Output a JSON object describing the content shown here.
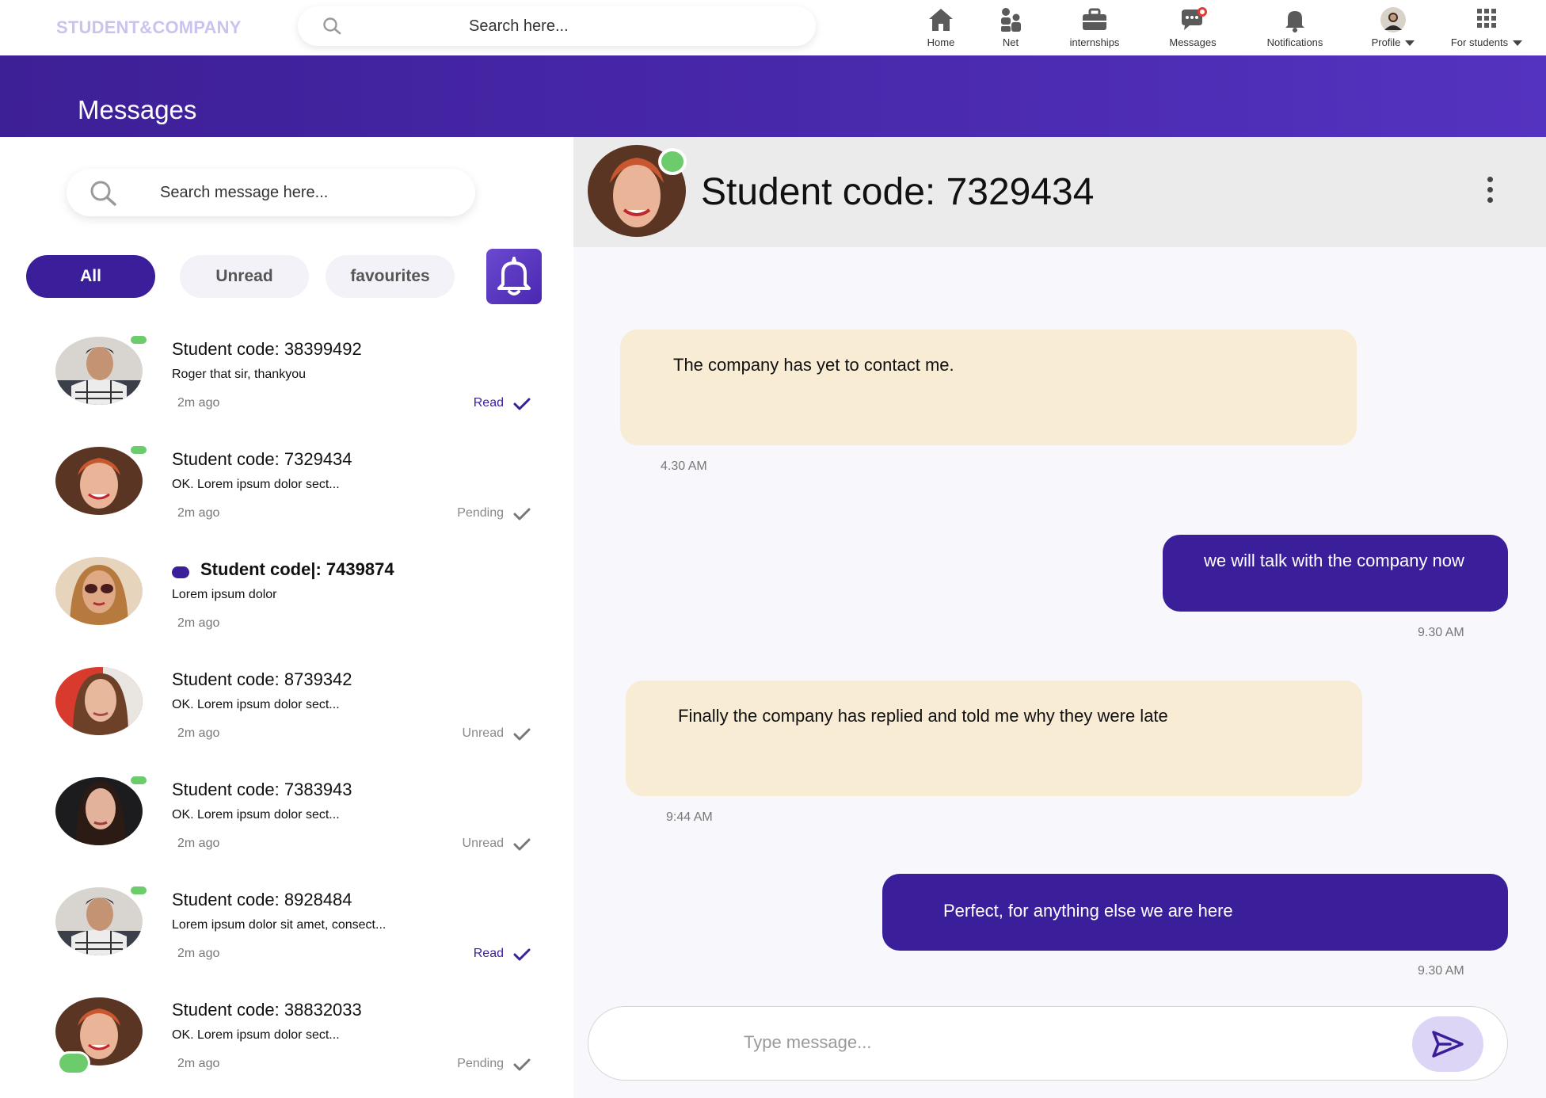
{
  "app": {
    "logo": "STUDENT&COMPANY"
  },
  "top_search": {
    "placeholder": "Search  here..."
  },
  "nav": [
    {
      "label": "Home",
      "icon": "home-icon"
    },
    {
      "label": "Net",
      "icon": "people-icon"
    },
    {
      "label": "internships",
      "icon": "briefcase-icon"
    },
    {
      "label": "Messages",
      "icon": "chat-icon"
    },
    {
      "label": "Notifications",
      "icon": "bell-icon"
    },
    {
      "label": "Profile",
      "icon": "avatar"
    },
    {
      "label": "For students",
      "icon": "grid-icon"
    }
  ],
  "page": {
    "title": "Messages"
  },
  "message_search": {
    "placeholder": "Search message  here..."
  },
  "filters": {
    "all": "All",
    "unread": "Unread",
    "favourites": "favourites"
  },
  "conversations": [
    {
      "title": "Student code: 38399492",
      "preview": "Roger that sir, thankyou",
      "time": "2m ago",
      "status": "Read",
      "online": true
    },
    {
      "title": "Student code: 7329434",
      "preview": "OK. Lorem ipsum dolor sect...",
      "time": "2m ago",
      "status": "Pending",
      "online": true
    },
    {
      "title": "Student code|: 7439874",
      "preview": "Lorem ipsum dolor",
      "time": "2m ago",
      "status": "",
      "online": false,
      "unread": true
    },
    {
      "title": "Student code: 8739342",
      "preview": "OK. Lorem ipsum dolor sect...",
      "time": "2m ago",
      "status": "Unread",
      "online": false
    },
    {
      "title": "Student code: 7383943",
      "preview": "OK. Lorem ipsum dolor sect...",
      "time": "2m ago",
      "status": "Unread",
      "online": true
    },
    {
      "title": "Student code: 8928484",
      "preview": "Lorem ipsum dolor sit amet, consect...",
      "time": "2m ago",
      "status": "Read",
      "online": true
    },
    {
      "title": "Student code: 38832033",
      "preview": "OK. Lorem ipsum dolor sect...",
      "time": "2m ago",
      "status": "Pending",
      "online": true
    }
  ],
  "chat": {
    "title": "Student code: 7329434",
    "messages": [
      {
        "direction": "in",
        "text": "The company has yet to contact me.",
        "time": "4.30 AM"
      },
      {
        "direction": "out",
        "text": "we will talk with the company now",
        "time": "9.30 AM"
      },
      {
        "direction": "in",
        "text": "Finally the company has replied and told me why they were late",
        "time": "9:44 AM"
      },
      {
        "direction": "out",
        "text": "Perfect, for anything else we are here",
        "time": "9.30 AM"
      }
    ],
    "composer_placeholder": "Type message..."
  },
  "colors": {
    "accent": "#3b1e9a",
    "incoming_bubble": "#f8ecd5",
    "online": "#6ccb6a",
    "logo": "#c9c3f0"
  }
}
